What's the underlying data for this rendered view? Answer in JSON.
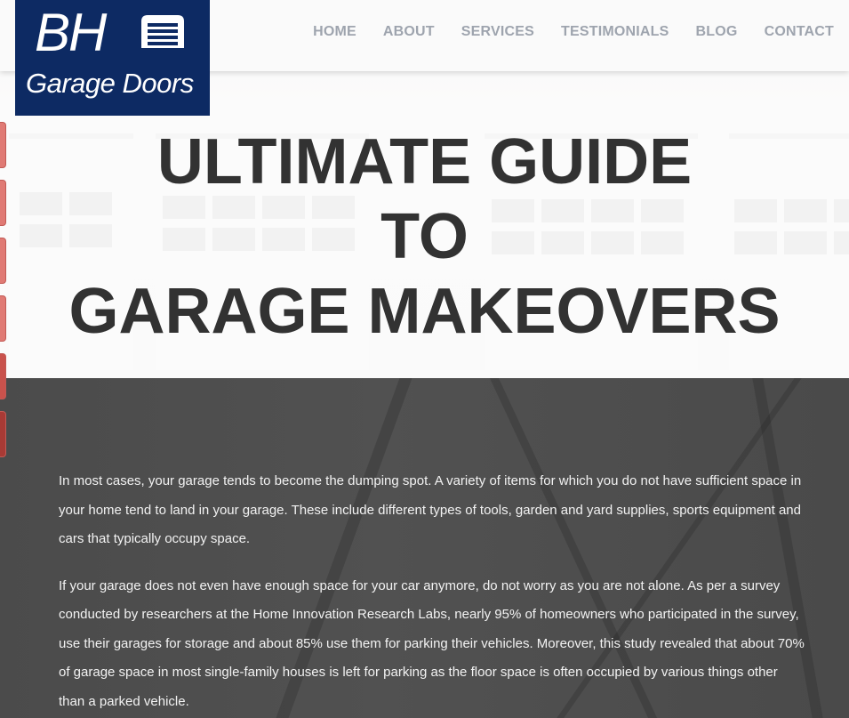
{
  "logo": {
    "initials": "BH",
    "subtitle": "Garage Doors",
    "icon": "garage-door-icon"
  },
  "nav": {
    "items": [
      {
        "label": "HOME"
      },
      {
        "label": "ABOUT"
      },
      {
        "label": "SERVICES"
      },
      {
        "label": "TESTIMONIALS"
      },
      {
        "label": "BLOG"
      },
      {
        "label": "CONTACT"
      }
    ]
  },
  "hero": {
    "title_lines": [
      "ULTIMATE GUIDE",
      "TO",
      "GARAGE MAKEOVERS"
    ]
  },
  "article": {
    "paragraphs": [
      "In most cases, your garage tends to become the dumping spot. A variety of items for which you do not have sufficient space in your home tend to land in your garage. These include different types of tools, garden and yard supplies, sports equipment and cars that typically occupy space.",
      "If your garage does not even have enough space for your car anymore, do not worry as you are not alone. As per a survey conducted by researchers at the Home Innovation Research Labs, nearly 95% of homeowners who participated in the survey, use their garages for storage and about 85% use them for parking their vehicles. Moreover, this study revealed that about 70% of garage space in most single-family houses is left for parking as the floor space is often occupied by various things other than a parked vehicle."
    ]
  },
  "colors": {
    "logo_bg": "#0d2a63",
    "nav_text": "#9ea4ae",
    "title_text": "#323232",
    "dark_section": "#4e4e4e",
    "side_tab": "#e07a74"
  }
}
